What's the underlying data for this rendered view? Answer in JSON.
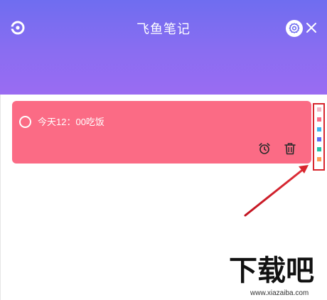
{
  "header": {
    "title": "飞鱼笔记",
    "logo_icon": "app-logo-icon",
    "settings_icon": "gear-icon",
    "close_icon": "close-icon",
    "gradient": [
      "#6f6df0",
      "#9a6cf2"
    ]
  },
  "notes": [
    {
      "text": "今天12：00吃饭",
      "color": "#fb6b85",
      "checked": false,
      "actions": [
        "alarm-clock-icon",
        "trash-icon"
      ]
    }
  ],
  "palette": {
    "swatches": [
      "#f4b6c4",
      "#fb6b85",
      "#3fb4f0",
      "#5b6ef5",
      "#25c2a6",
      "#ff9b52"
    ],
    "highlight_color": "#d8262e"
  },
  "watermark": {
    "big": "下载吧",
    "small": "www.xiazaiba.com"
  }
}
